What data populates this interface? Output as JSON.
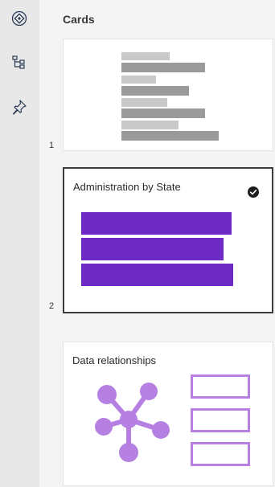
{
  "header": {
    "title": "Cards"
  },
  "rail": {
    "items": [
      {
        "icon": "navigator-icon"
      },
      {
        "icon": "hierarchy-icon"
      },
      {
        "icon": "pin-icon"
      }
    ]
  },
  "cards": [
    {
      "number": "1",
      "title": "",
      "preview": "gray-bars"
    },
    {
      "number": "2",
      "title": "Administration by State",
      "selected": true,
      "preview": "purple-bars"
    },
    {
      "number": "",
      "title": "Data relationships",
      "preview": "network"
    }
  ],
  "colors": {
    "rail_bg": "#e8e8e8",
    "page_bg": "#f4f4f4",
    "bar_light": "#c9c9c9",
    "bar_dark": "#9a9a9a",
    "purple_bar": "#6d2ac4",
    "purple_light": "#b680e3",
    "check": "#1e1e1e",
    "icon": "#2b3a55"
  }
}
